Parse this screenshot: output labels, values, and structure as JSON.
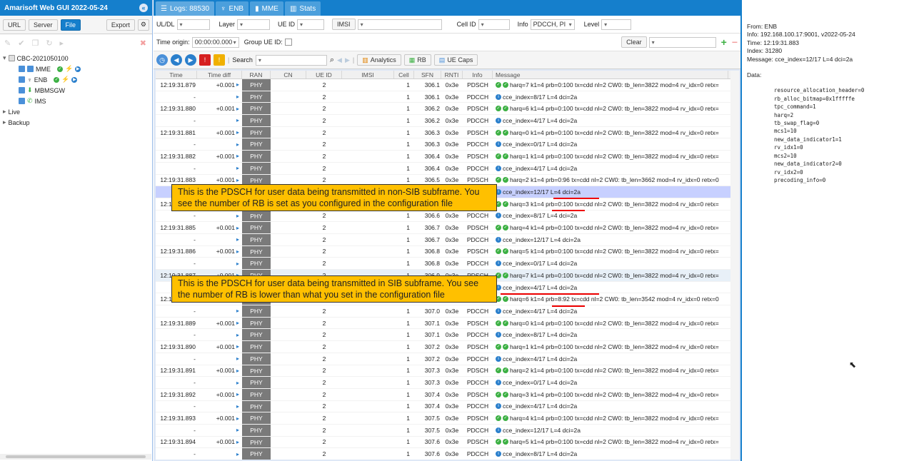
{
  "app": {
    "title": "Amarisoft Web GUI 2022-05-24"
  },
  "left_toolbar": {
    "url": "URL",
    "server": "Server",
    "file": "File",
    "export": "Export"
  },
  "tree": {
    "root": "CBC-2021050100",
    "mme": "MME",
    "enb": "ENB",
    "mbmsgw": "MBMSGW",
    "ims": "IMS",
    "live": "Live",
    "backup": "Backup"
  },
  "tabs": [
    {
      "label": "Logs: 88530"
    },
    {
      "label": "ENB"
    },
    {
      "label": "MME"
    },
    {
      "label": "Stats"
    }
  ],
  "filters": {
    "uldl": "UL/DL",
    "layer": "Layer",
    "ueid": "UE ID",
    "imsi": "IMSI",
    "cellid": "Cell ID",
    "info": "Info",
    "info_value": "PDCCH, PI",
    "level": "Level",
    "time_origin": "Time origin:",
    "time_origin_value": "00:00:00.000",
    "group_ue": "Group UE ID:",
    "clear": "Clear"
  },
  "toolbar": {
    "search": "Search",
    "analytics": "Analytics",
    "rb": "RB",
    "ue_caps": "UE Caps"
  },
  "columns": [
    "Time",
    "Time diff",
    "RAN",
    "CN",
    "UE ID",
    "IMSI",
    "Cell",
    "SFN",
    "RNTI",
    "Info",
    "Message"
  ],
  "rows": [
    {
      "time": "12:19:31.879",
      "diff": "+0.001",
      "ran": "PHY",
      "ue": "2",
      "cell": "1",
      "sfn": "306.1",
      "rnti": "0x3e",
      "info": "PDSCH",
      "msg": "harq=7 k1=4 prb=0:100 tx=cdd nl=2 CW0: tb_len=3822 mod=4 rv_idx=0 retx=",
      "kind": "g"
    },
    {
      "time": "-",
      "diff": "",
      "ran": "PHY",
      "ue": "2",
      "cell": "1",
      "sfn": "306.1",
      "rnti": "0x3e",
      "info": "PDCCH",
      "msg": "cce_index=8/17 L=4 dci=2a",
      "kind": "i"
    },
    {
      "time": "12:19:31.880",
      "diff": "+0.001",
      "ran": "PHY",
      "ue": "2",
      "cell": "1",
      "sfn": "306.2",
      "rnti": "0x3e",
      "info": "PDSCH",
      "msg": "harq=6 k1=4 prb=0:100 tx=cdd nl=2 CW0: tb_len=3822 mod=4 rv_idx=0 retx=",
      "kind": "g"
    },
    {
      "time": "-",
      "diff": "",
      "ran": "PHY",
      "ue": "2",
      "cell": "1",
      "sfn": "306.2",
      "rnti": "0x3e",
      "info": "PDCCH",
      "msg": "cce_index=4/17 L=4 dci=2a",
      "kind": "i"
    },
    {
      "time": "12:19:31.881",
      "diff": "+0.001",
      "ran": "PHY",
      "ue": "2",
      "cell": "1",
      "sfn": "306.3",
      "rnti": "0x3e",
      "info": "PDSCH",
      "msg": "harq=0 k1=4 prb=0:100 tx=cdd nl=2 CW0: tb_len=3822 mod=4 rv_idx=0 retx=",
      "kind": "g"
    },
    {
      "time": "-",
      "diff": "",
      "ran": "PHY",
      "ue": "2",
      "cell": "1",
      "sfn": "306.3",
      "rnti": "0x3e",
      "info": "PDCCH",
      "msg": "cce_index=0/17 L=4 dci=2a",
      "kind": "i"
    },
    {
      "time": "12:19:31.882",
      "diff": "+0.001",
      "ran": "PHY",
      "ue": "2",
      "cell": "1",
      "sfn": "306.4",
      "rnti": "0x3e",
      "info": "PDSCH",
      "msg": "harq=1 k1=4 prb=0:100 tx=cdd nl=2 CW0: tb_len=3822 mod=4 rv_idx=0 retx=",
      "kind": "g"
    },
    {
      "time": "-",
      "diff": "",
      "ran": "PHY",
      "ue": "2",
      "cell": "1",
      "sfn": "306.4",
      "rnti": "0x3e",
      "info": "PDCCH",
      "msg": "cce_index=4/17 L=4 dci=2a",
      "kind": "i"
    },
    {
      "time": "12:19:31.883",
      "diff": "+0.001",
      "ran": "PHY",
      "ue": "2",
      "cell": "1",
      "sfn": "306.5",
      "rnti": "0x3e",
      "info": "PDSCH",
      "msg": "harq=2 k1=4 prb=0:96 tx=cdd nl=2 CW0: tb_len=3662 mod=4 rv_idx=0 retx=0",
      "kind": "g"
    },
    {
      "time": "-",
      "diff": "",
      "ran": "PHY",
      "ue": "2",
      "cell": "1",
      "sfn": "306.5",
      "rnti": "0x3e",
      "info": "PDCCH",
      "msg": "cce_index=12/17 L=4 dci=2a",
      "kind": "i",
      "hl": true
    },
    {
      "time": "12:19:31.884",
      "diff": "+0.001",
      "ran": "PHY",
      "ue": "2",
      "cell": "1",
      "sfn": "306.6",
      "rnti": "0x3e",
      "info": "PDSCH",
      "msg": "harq=3 k1=4 prb=0:100 tx=cdd nl=2 CW0: tb_len=3822 mod=4 rv_idx=0 retx=",
      "kind": "g"
    },
    {
      "time": "-",
      "diff": "",
      "ran": "PHY",
      "ue": "2",
      "cell": "1",
      "sfn": "306.6",
      "rnti": "0x3e",
      "info": "PDCCH",
      "msg": "cce_index=8/17 L=4 dci=2a",
      "kind": "i"
    },
    {
      "time": "12:19:31.885",
      "diff": "+0.001",
      "ran": "PHY",
      "ue": "2",
      "cell": "1",
      "sfn": "306.7",
      "rnti": "0x3e",
      "info": "PDSCH",
      "msg": "harq=4 k1=4 prb=0:100 tx=cdd nl=2 CW0: tb_len=3822 mod=4 rv_idx=0 retx=",
      "kind": "g"
    },
    {
      "time": "-",
      "diff": "",
      "ran": "PHY",
      "ue": "2",
      "cell": "1",
      "sfn": "306.7",
      "rnti": "0x3e",
      "info": "PDCCH",
      "msg": "cce_index=12/17 L=4 dci=2a",
      "kind": "i"
    },
    {
      "time": "12:19:31.886",
      "diff": "+0.001",
      "ran": "PHY",
      "ue": "2",
      "cell": "1",
      "sfn": "306.8",
      "rnti": "0x3e",
      "info": "PDSCH",
      "msg": "harq=5 k1=4 prb=0:100 tx=cdd nl=2 CW0: tb_len=3822 mod=4 rv_idx=0 retx=",
      "kind": "g"
    },
    {
      "time": "-",
      "diff": "",
      "ran": "PHY",
      "ue": "2",
      "cell": "1",
      "sfn": "306.8",
      "rnti": "0x3e",
      "info": "PDCCH",
      "msg": "cce_index=0/17 L=4 dci=2a",
      "kind": "i"
    },
    {
      "time": "12:19:31.887",
      "diff": "+0.001",
      "ran": "PHY",
      "ue": "2",
      "cell": "1",
      "sfn": "306.9",
      "rnti": "0x3e",
      "info": "PDSCH",
      "msg": "harq=7 k1=4 prb=0:100 tx=cdd nl=2 CW0: tb_len=3822 mod=4 rv_idx=0 retx=",
      "kind": "g",
      "ht": true
    },
    {
      "time": "-",
      "diff": "",
      "ran": "PHY",
      "ue": "2",
      "cell": "1",
      "sfn": "306.9",
      "rnti": "0x3e",
      "info": "PDCCH",
      "msg": "cce_index=4/17 L=4 dci=2a",
      "kind": "i"
    },
    {
      "time": "12:19:31.888",
      "diff": "+0.001",
      "ran": "PHY",
      "ue": "2",
      "cell": "1",
      "sfn": "307.0",
      "rnti": "0x3e",
      "info": "PDSCH",
      "msg": "harq=6 k1=4 prb=8:92 tx=cdd nl=2 CW0: tb_len=3542 mod=4 rv_idx=0 retx=0",
      "kind": "g"
    },
    {
      "time": "-",
      "diff": "",
      "ran": "PHY",
      "ue": "2",
      "cell": "1",
      "sfn": "307.0",
      "rnti": "0x3e",
      "info": "PDCCH",
      "msg": "cce_index=4/17 L=4 dci=2a",
      "kind": "i"
    },
    {
      "time": "12:19:31.889",
      "diff": "+0.001",
      "ran": "PHY",
      "ue": "2",
      "cell": "1",
      "sfn": "307.1",
      "rnti": "0x3e",
      "info": "PDSCH",
      "msg": "harq=0 k1=4 prb=0:100 tx=cdd nl=2 CW0: tb_len=3822 mod=4 rv_idx=0 retx=",
      "kind": "g"
    },
    {
      "time": "-",
      "diff": "",
      "ran": "PHY",
      "ue": "2",
      "cell": "1",
      "sfn": "307.1",
      "rnti": "0x3e",
      "info": "PDCCH",
      "msg": "cce_index=8/17 L=4 dci=2a",
      "kind": "i"
    },
    {
      "time": "12:19:31.890",
      "diff": "+0.001",
      "ran": "PHY",
      "ue": "2",
      "cell": "1",
      "sfn": "307.2",
      "rnti": "0x3e",
      "info": "PDSCH",
      "msg": "harq=1 k1=4 prb=0:100 tx=cdd nl=2 CW0: tb_len=3822 mod=4 rv_idx=0 retx=",
      "kind": "g"
    },
    {
      "time": "-",
      "diff": "",
      "ran": "PHY",
      "ue": "2",
      "cell": "1",
      "sfn": "307.2",
      "rnti": "0x3e",
      "info": "PDCCH",
      "msg": "cce_index=4/17 L=4 dci=2a",
      "kind": "i"
    },
    {
      "time": "12:19:31.891",
      "diff": "+0.001",
      "ran": "PHY",
      "ue": "2",
      "cell": "1",
      "sfn": "307.3",
      "rnti": "0x3e",
      "info": "PDSCH",
      "msg": "harq=2 k1=4 prb=0:100 tx=cdd nl=2 CW0: tb_len=3822 mod=4 rv_idx=0 retx=",
      "kind": "g"
    },
    {
      "time": "-",
      "diff": "",
      "ran": "PHY",
      "ue": "2",
      "cell": "1",
      "sfn": "307.3",
      "rnti": "0x3e",
      "info": "PDCCH",
      "msg": "cce_index=0/17 L=4 dci=2a",
      "kind": "i"
    },
    {
      "time": "12:19:31.892",
      "diff": "+0.001",
      "ran": "PHY",
      "ue": "2",
      "cell": "1",
      "sfn": "307.4",
      "rnti": "0x3e",
      "info": "PDSCH",
      "msg": "harq=3 k1=4 prb=0:100 tx=cdd nl=2 CW0: tb_len=3822 mod=4 rv_idx=0 retx=",
      "kind": "g"
    },
    {
      "time": "-",
      "diff": "",
      "ran": "PHY",
      "ue": "2",
      "cell": "1",
      "sfn": "307.4",
      "rnti": "0x3e",
      "info": "PDCCH",
      "msg": "cce_index=4/17 L=4 dci=2a",
      "kind": "i"
    },
    {
      "time": "12:19:31.893",
      "diff": "+0.001",
      "ran": "PHY",
      "ue": "2",
      "cell": "1",
      "sfn": "307.5",
      "rnti": "0x3e",
      "info": "PDSCH",
      "msg": "harq=4 k1=4 prb=0:100 tx=cdd nl=2 CW0: tb_len=3822 mod=4 rv_idx=0 retx=",
      "kind": "g"
    },
    {
      "time": "-",
      "diff": "",
      "ran": "PHY",
      "ue": "2",
      "cell": "1",
      "sfn": "307.5",
      "rnti": "0x3e",
      "info": "PDCCH",
      "msg": "cce_index=12/17 L=4 dci=2a",
      "kind": "i"
    },
    {
      "time": "12:19:31.894",
      "diff": "+0.001",
      "ran": "PHY",
      "ue": "2",
      "cell": "1",
      "sfn": "307.6",
      "rnti": "0x3e",
      "info": "PDSCH",
      "msg": "harq=5 k1=4 prb=0:100 tx=cdd nl=2 CW0: tb_len=3822 mod=4 rv_idx=0 retx=",
      "kind": "g"
    },
    {
      "time": "-",
      "diff": "",
      "ran": "PHY",
      "ue": "2",
      "cell": "1",
      "sfn": "307.6",
      "rnti": "0x3e",
      "info": "PDCCH",
      "msg": "cce_index=8/17 L=4 dci=2a",
      "kind": "i"
    }
  ],
  "annotations": {
    "non_sib": "This is the PDSCH for user data being transmitted in non-SIB subframe. You see the number of RB is set as you configured in the configuration file",
    "sib": "This is the PDSCH for user data being transmitted in SIB subframe. You see the number of RB is lower than what you set in the configuration file"
  },
  "detail": {
    "from": "From: ENB",
    "info": "Info: 192.168.100.17:9001, v2022-05-24",
    "time": "Time: 12:19:31.883",
    "index": "Index: 31280",
    "message": "Message: cce_index=12/17 L=4 dci=2a",
    "data_label": "Data:",
    "data": "resource_allocation_header=0\nrb_alloc_bitmap=0x1fffffe\ntpc_command=1\nharq=2\ntb_swap_flag=0\nmcs1=10\nnew_data_indicator1=1\nrv_idx1=0\nmcs2=10\nnew_data_indicator2=0\nrv_idx2=0\nprecoding_info=0"
  }
}
